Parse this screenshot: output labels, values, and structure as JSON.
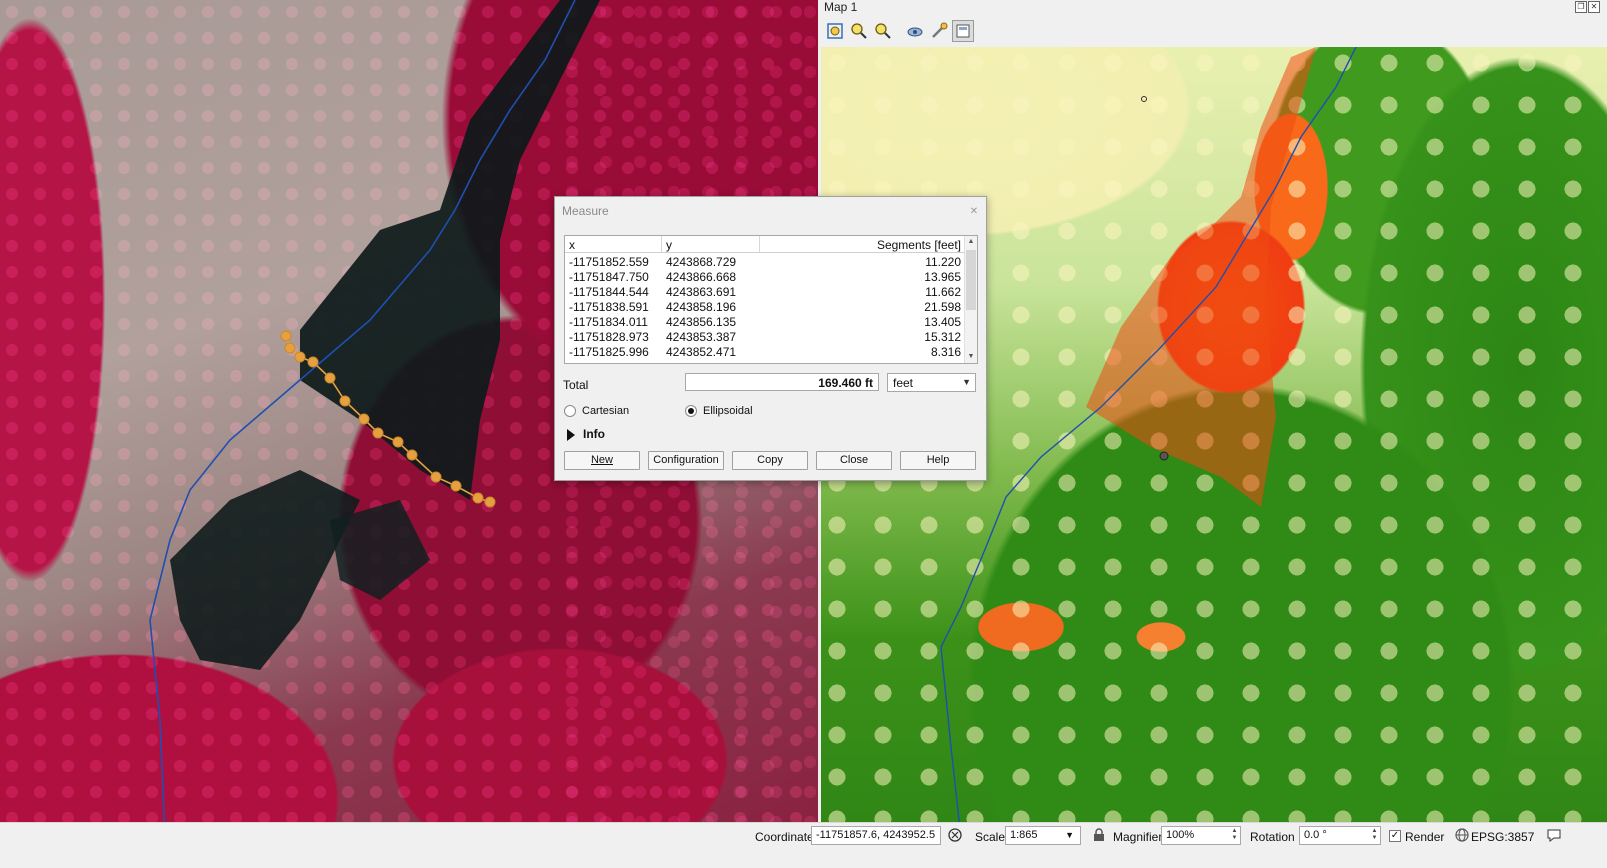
{
  "map1": {
    "title": "Map 1",
    "toolbar_icons": [
      "zoom-full-icon",
      "zoom-in-icon",
      "zoom-out-icon",
      "show-layer-icon",
      "settings-wrench-icon",
      "sync-view-icon"
    ]
  },
  "measure": {
    "title": "Measure",
    "columns": {
      "x": "x",
      "y": "y",
      "segments": "Segments [feet]"
    },
    "rows": [
      {
        "x": "-11751852.559",
        "y": "4243868.729",
        "segment": "11.220"
      },
      {
        "x": "-11751847.750",
        "y": "4243866.668",
        "segment": "13.965"
      },
      {
        "x": "-11751844.544",
        "y": "4243863.691",
        "segment": "11.662"
      },
      {
        "x": "-11751838.591",
        "y": "4243858.196",
        "segment": "21.598"
      },
      {
        "x": "-11751834.011",
        "y": "4243856.135",
        "segment": "13.405"
      },
      {
        "x": "-11751828.973",
        "y": "4243853.387",
        "segment": "15.312"
      },
      {
        "x": "-11751825.996",
        "y": "4243852.471",
        "segment": "8.316"
      }
    ],
    "total_label": "Total",
    "total_value": "169.460 ft",
    "unit": "feet",
    "radio_cartesian": "Cartesian",
    "radio_ellipsoidal": "Ellipsoidal",
    "selected_mode": "Ellipsoidal",
    "info_label": "Info",
    "buttons": {
      "new": "New",
      "configuration": "Configuration",
      "copy": "Copy",
      "close": "Close",
      "help": "Help"
    }
  },
  "statusbar": {
    "coordinate_label": "Coordinate",
    "coordinate_value": "-11751857.6, 4243952.5",
    "scale_label": "Scale",
    "scale_value": "1:865",
    "magnifier_label": "Magnifier",
    "magnifier_value": "100%",
    "rotation_label": "Rotation",
    "rotation_value": "0.0 °",
    "render_label": "Render",
    "render_checked": true,
    "crs": "EPSG:3857"
  },
  "colors": {
    "measure_line": "#e6a040",
    "stream_line": "#1f4fb0",
    "selection": "#3060c0"
  }
}
